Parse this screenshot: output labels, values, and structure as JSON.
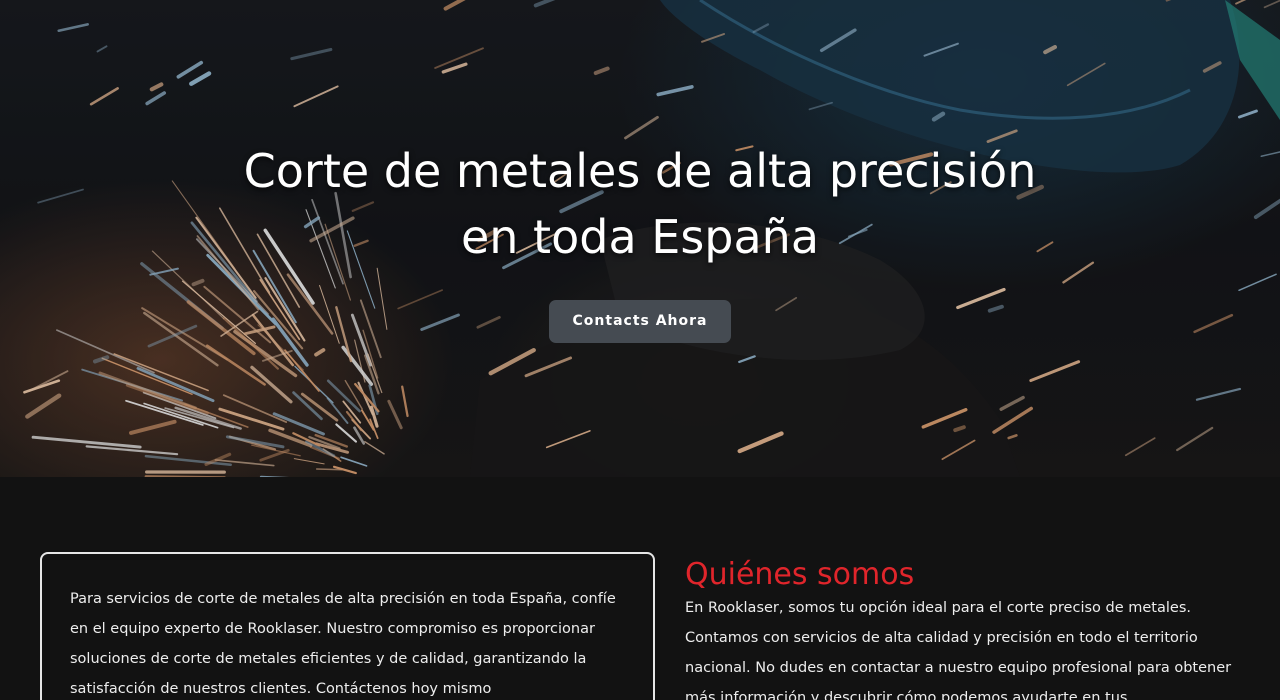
{
  "hero": {
    "background_image": "metal-cutting-sparks",
    "title": "Corte de metales de alta precisión en toda España",
    "cta_label": "Contacts Ahora"
  },
  "info_card": {
    "text": "Para servicios de corte de metales de alta precisión en toda España, confíe en el equipo experto de Rooklaser. Nuestro compromiso es proporcionar soluciones de corte de metales eficientes y de calidad, garantizando la satisfacción de nuestros clientes. Contáctenos hoy mismo"
  },
  "about": {
    "heading": "Quiénes somos",
    "text": "En Rooklaser, somos tu opción ideal para el corte preciso de metales. Contamos con servicios de alta calidad y precisión en todo el territorio nacional. No dudes en contactar a nuestro equipo profesional para obtener más información y descubrir cómo podemos ayudarte en tus"
  },
  "colors": {
    "page_background": "#121212",
    "heading_accent": "#e0252b",
    "button_background": "#454b52",
    "card_border": "#e6e6e6"
  }
}
